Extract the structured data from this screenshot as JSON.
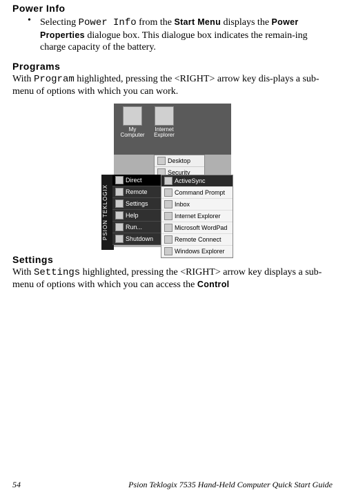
{
  "section1": {
    "title": "Power Info",
    "bullet_pre": "Selecting ",
    "bullet_mono": "Power Info",
    "bullet_mid": " from the ",
    "bullet_sans1": "Start Menu",
    "bullet_mid2": " displays the ",
    "bullet_sans2": "Power Properties",
    "bullet_tail": " dialogue box. This dialogue box indicates the remain-ing charge capacity of the battery."
  },
  "section2": {
    "title": "Programs",
    "p_pre": "With ",
    "p_mono": "Program",
    "p_tail": " highlighted, pressing the <RIGHT> arrow key dis-plays a sub-menu of options with which you can work."
  },
  "screenshot": {
    "icon1": "My Computer",
    "icon2": "Internet Explorer",
    "desk1": "Desktop",
    "desk2": "Security",
    "brand": "PSION TEKLOGIX",
    "start": [
      "Direct",
      "Remote",
      "Settings",
      "Help",
      "Run...",
      "Shutdown"
    ],
    "start_underline_idx": [
      0,
      0,
      0,
      0,
      0,
      2
    ],
    "cascade": [
      "ActiveSync",
      "Command Prompt",
      "Inbox",
      "Internet Explorer",
      "Microsoft WordPad",
      "Remote Connect",
      "Windows Explorer"
    ]
  },
  "section3": {
    "title": "Settings",
    "p_pre": "With ",
    "p_mono": "Settings",
    "p_mid": " highlighted, pressing the <RIGHT> arrow key displays a sub-menu of options with which you can access the ",
    "p_sans": "Control"
  },
  "footer": {
    "page": "54",
    "doc": "Psion Teklogix 7535 Hand-Held Computer Quick Start Guide"
  }
}
